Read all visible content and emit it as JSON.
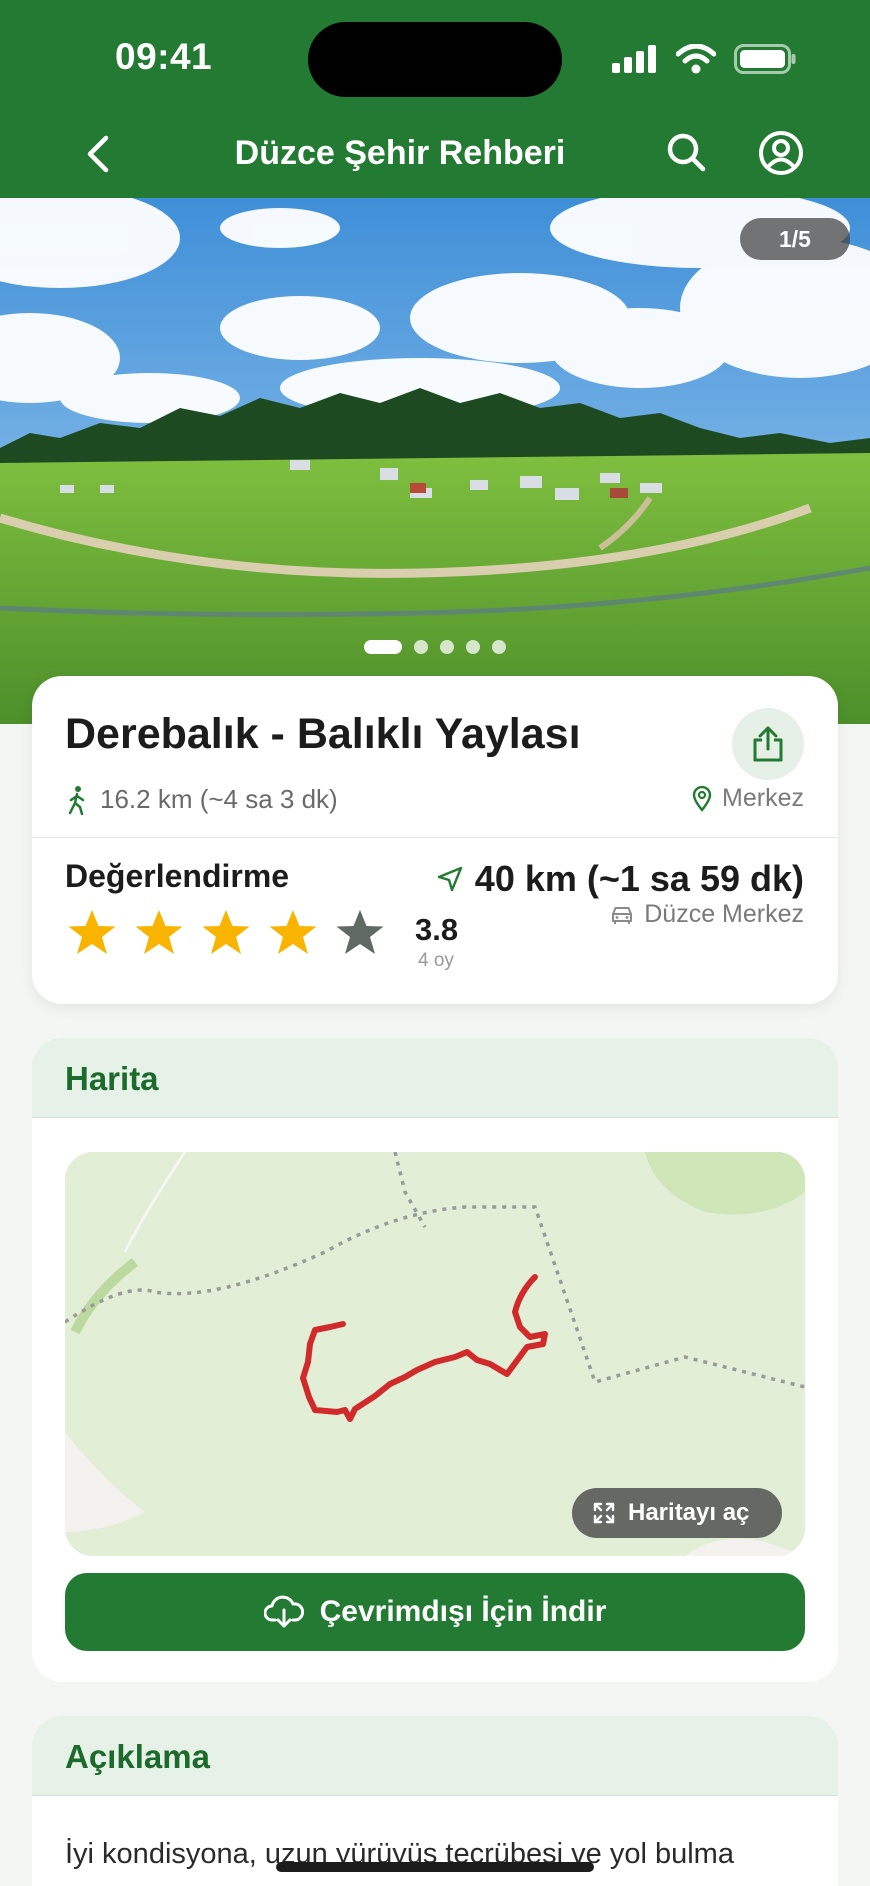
{
  "status": {
    "time": "09:41"
  },
  "header": {
    "title": "Düzce Şehir Rehberi"
  },
  "hero": {
    "counter": "1/5",
    "slides": 5,
    "active_slide": 1
  },
  "place": {
    "title": "Derebalık - Balıklı Yaylası",
    "walk_info": "16.2 km (~4 sa 3 dk)",
    "district": "Merkez",
    "rating_label": "Değerlendirme",
    "rating": "3.8",
    "rating_value": 3.8,
    "votes": "4 oy",
    "drive_distance": "40 km (~1 sa 59 dk)",
    "drive_from": "Düzce Merkez"
  },
  "map_section": {
    "title": "Harita",
    "open_map_label": "Haritayı aç",
    "download_label": "Çevrimdışı İçin İndir"
  },
  "description": {
    "title": "Açıklama",
    "text": "İyi kondisyona, uzun yürüyüş tecrübesi ve yol bulma"
  },
  "colors": {
    "brand_green": "#237a33",
    "star_filled": "#f8b400",
    "star_empty": "#5f6a63",
    "route_red": "#d02a2a"
  },
  "icons": [
    "back-chevron-icon",
    "search-icon",
    "profile-icon",
    "share-icon",
    "walking-icon",
    "location-pin-icon",
    "navigation-arrow-icon",
    "car-icon",
    "expand-icon",
    "cloud-download-icon"
  ]
}
